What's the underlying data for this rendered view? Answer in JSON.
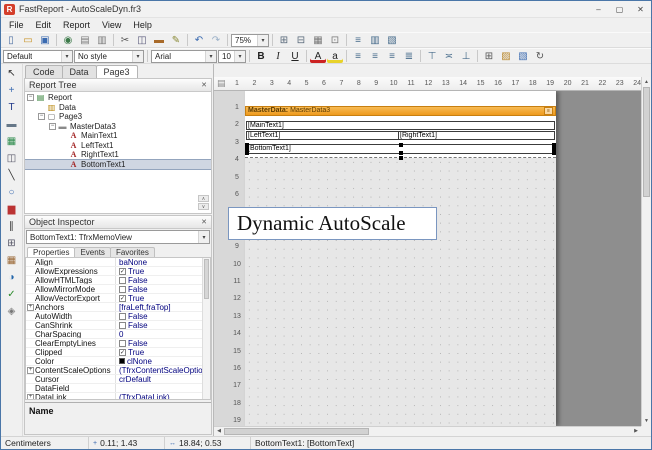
{
  "window": {
    "title": "FastReport - AutoScaleDyn.fr3",
    "icon": "R",
    "buttons": [
      {
        "name": "minimize-button",
        "glyph": "–"
      },
      {
        "name": "maximize-button",
        "glyph": "▢"
      },
      {
        "name": "close-button",
        "glyph": "✕"
      }
    ]
  },
  "menu": {
    "items": [
      "File",
      "Edit",
      "Report",
      "View",
      "Help"
    ]
  },
  "toolbar1": {
    "items": [
      {
        "type": "icon",
        "name": "new-report-button",
        "glyph": "▯",
        "color": "#4a6da0"
      },
      {
        "type": "icon",
        "name": "open-report-button",
        "glyph": "▭",
        "color": "#c89020"
      },
      {
        "type": "icon",
        "name": "save-report-button",
        "glyph": "▣",
        "color": "#3a6ab0"
      },
      {
        "type": "sep"
      },
      {
        "type": "icon",
        "name": "preview-button",
        "glyph": "◉",
        "color": "#3d7a4a"
      },
      {
        "type": "icon",
        "name": "new-page-button",
        "glyph": "▤",
        "color": "#7a7a7a"
      },
      {
        "type": "icon",
        "name": "page-settings-button",
        "glyph": "▥",
        "color": "#7a7a7a"
      },
      {
        "type": "sep"
      },
      {
        "type": "icon",
        "name": "cut-button",
        "glyph": "✂",
        "color": "#555555"
      },
      {
        "type": "icon",
        "name": "copy-button",
        "glyph": "◫",
        "color": "#555577"
      },
      {
        "type": "icon",
        "name": "paste-button",
        "glyph": "▬",
        "color": "#a86a2a"
      },
      {
        "type": "icon",
        "name": "format-painter-button",
        "glyph": "✎",
        "color": "#888833"
      },
      {
        "type": "sep"
      },
      {
        "type": "icon",
        "name": "undo-button",
        "glyph": "↶",
        "color": "#3a6ab0"
      },
      {
        "type": "icon",
        "name": "redo-button",
        "glyph": "↷",
        "color": "#9ab0c8"
      },
      {
        "type": "sep"
      },
      {
        "type": "combo",
        "name": "zoom-select",
        "value": "75%",
        "width": 38
      },
      {
        "type": "sep"
      },
      {
        "type": "icon",
        "name": "group-button",
        "glyph": "⊞",
        "color": "#556677"
      },
      {
        "type": "icon",
        "name": "ungroup-button",
        "glyph": "⊟",
        "color": "#556677"
      },
      {
        "type": "icon",
        "name": "show-grid-button",
        "glyph": "▦",
        "color": "#777777"
      },
      {
        "type": "icon",
        "name": "align-to-grid-button",
        "glyph": "⊡",
        "color": "#777777"
      },
      {
        "type": "sep"
      },
      {
        "type": "icon",
        "name": "report-tree-toggle",
        "glyph": "≡",
        "color": "#456a8a"
      },
      {
        "type": "icon",
        "name": "data-tree-toggle",
        "glyph": "▥",
        "color": "#456a8a"
      },
      {
        "type": "icon",
        "name": "inspector-toggle",
        "glyph": "▧",
        "color": "#456a8a"
      }
    ]
  },
  "toolbar2": {
    "items": [
      {
        "type": "combo",
        "name": "style-select",
        "value": "Default",
        "width": 70
      },
      {
        "type": "combo",
        "name": "style2-select",
        "value": "No style",
        "width": 70
      },
      {
        "type": "sep"
      },
      {
        "type": "combo",
        "name": "font-select",
        "value": "Arial",
        "width": 66
      },
      {
        "type": "combo",
        "name": "font-size-select",
        "value": "10",
        "width": 28
      },
      {
        "type": "sep"
      },
      {
        "type": "icon",
        "name": "bold-button",
        "glyph": "B",
        "b": true,
        "color": "#222222"
      },
      {
        "type": "icon",
        "name": "italic-button",
        "glyph": "I",
        "i": true,
        "color": "#222222"
      },
      {
        "type": "icon",
        "name": "underline-button",
        "glyph": "U",
        "u": true,
        "color": "#222222"
      },
      {
        "type": "sep"
      },
      {
        "type": "icon",
        "name": "font-color-button",
        "glyph": "A",
        "color": "#222222",
        "bar": "#cc2222"
      },
      {
        "type": "icon",
        "name": "highlight-color-button",
        "glyph": "a",
        "color": "#222222",
        "bar": "#e8d22a"
      },
      {
        "type": "sep"
      },
      {
        "type": "icon",
        "name": "align-left-button",
        "glyph": "≡",
        "color": "#456a8a"
      },
      {
        "type": "icon",
        "name": "align-center-button",
        "glyph": "≡",
        "color": "#456a8a"
      },
      {
        "type": "icon",
        "name": "align-right-button",
        "glyph": "≡",
        "color": "#456a8a"
      },
      {
        "type": "icon",
        "name": "align-justify-button",
        "glyph": "≣",
        "color": "#456a8a"
      },
      {
        "type": "sep"
      },
      {
        "type": "icon",
        "name": "valign-top-button",
        "glyph": "⊤",
        "color": "#456a8a"
      },
      {
        "type": "icon",
        "name": "valign-middle-button",
        "glyph": "≍",
        "color": "#456a8a"
      },
      {
        "type": "icon",
        "name": "valign-bottom-button",
        "glyph": "⊥",
        "color": "#456a8a"
      },
      {
        "type": "sep"
      },
      {
        "type": "icon",
        "name": "borders-button",
        "glyph": "⊞",
        "color": "#555555"
      },
      {
        "type": "icon",
        "name": "fill-color-button",
        "glyph": "▨",
        "color": "#b8862a"
      },
      {
        "type": "icon",
        "name": "line-color-button",
        "glyph": "▧",
        "color": "#3a6ab0"
      },
      {
        "type": "icon",
        "name": "rotate-button",
        "glyph": "↻",
        "color": "#555555"
      }
    ]
  },
  "page_tabs": {
    "tabs": [
      {
        "label": "Code"
      },
      {
        "label": "Data"
      },
      {
        "label": "Page3",
        "active": true
      }
    ]
  },
  "tool_dock": {
    "items": [
      {
        "name": "select-tool",
        "glyph": "↖",
        "color": "#333333"
      },
      {
        "name": "hand-tool",
        "glyph": "+",
        "color": "#3a6ab0"
      },
      {
        "name": "text-object-tool",
        "glyph": "T",
        "color": "#223a8a"
      },
      {
        "name": "band-object-tool",
        "glyph": "▬",
        "color": "#667788"
      },
      {
        "name": "picture-object-tool",
        "glyph": "▦",
        "color": "#2a8a4a"
      },
      {
        "name": "subreport-object-tool",
        "glyph": "◫",
        "color": "#555566"
      },
      {
        "name": "line-object-tool",
        "glyph": "╲",
        "color": "#333333"
      },
      {
        "name": "shape-object-tool",
        "glyph": "○",
        "color": "#3a6ab0"
      },
      {
        "name": "chart-object-tool",
        "glyph": "▆",
        "color": "#bb3333"
      },
      {
        "name": "barcode-object-tool",
        "glyph": "∥",
        "color": "#333333"
      },
      {
        "name": "crosstab-object-tool",
        "glyph": "⊞",
        "color": "#555566"
      },
      {
        "name": "table-object-tool",
        "glyph": "▦",
        "color": "#996633"
      },
      {
        "name": "gauge-object-tool",
        "glyph": "◑",
        "color": "#2266aa"
      },
      {
        "name": "checkbox-object-tool",
        "glyph": "✓",
        "color": "#2a8a2a"
      },
      {
        "name": "map-object-tool",
        "glyph": "◈",
        "color": "#777777"
      }
    ]
  },
  "report_tree": {
    "title": "Report Tree",
    "nodes": [
      {
        "label": "Report",
        "depth": 0,
        "icon": "report",
        "expander": "−"
      },
      {
        "label": "Data",
        "depth": 1,
        "icon": "data"
      },
      {
        "label": "Page3",
        "depth": 1,
        "icon": "page",
        "expander": "−"
      },
      {
        "label": "MasterData3",
        "depth": 2,
        "icon": "band",
        "expander": "−"
      },
      {
        "label": "MainText1",
        "depth": 3,
        "icon": "memo"
      },
      {
        "label": "LeftText1",
        "depth": 3,
        "icon": "memo"
      },
      {
        "label": "RightText1",
        "depth": 3,
        "icon": "memo"
      },
      {
        "label": "BottomText1",
        "depth": 3,
        "icon": "memo",
        "selected": true
      }
    ]
  },
  "object_inspector": {
    "title": "Object Inspector",
    "selected_object": "BottomText1: TfrxMemoView",
    "tabs": [
      {
        "label": "Properties",
        "active": true
      },
      {
        "label": "Events"
      },
      {
        "label": "Favorites"
      }
    ],
    "properties": [
      {
        "name": "Align",
        "value": "baNone"
      },
      {
        "name": "AllowExpressions",
        "value": "True",
        "bool": true,
        "checked": true
      },
      {
        "name": "AllowHTMLTags",
        "value": "False",
        "bool": true,
        "checked": false
      },
      {
        "name": "AllowMirrorMode",
        "value": "False",
        "bool": true,
        "checked": false
      },
      {
        "name": "AllowVectorExport",
        "value": "True",
        "bool": true,
        "checked": true
      },
      {
        "name": "Anchors",
        "value": "[fraLeft,fraTop]",
        "expandable": true
      },
      {
        "name": "AutoWidth",
        "value": "False",
        "bool": true,
        "checked": false
      },
      {
        "name": "CanShrink",
        "value": "False",
        "bool": true,
        "checked": false
      },
      {
        "name": "CharSpacing",
        "value": "0"
      },
      {
        "name": "ClearEmptyLines",
        "value": "False",
        "bool": true,
        "checked": false
      },
      {
        "name": "Clipped",
        "value": "True",
        "bool": true,
        "checked": true
      },
      {
        "name": "Color",
        "value": "clNone",
        "swatch": "#000000"
      },
      {
        "name": "ContentScaleOptions",
        "value": "(TfrxContentScaleOptions)",
        "expandable": true
      },
      {
        "name": "Cursor",
        "value": "crDefault"
      },
      {
        "name": "DataField",
        "value": ""
      },
      {
        "name": "DataLink",
        "value": "(TfrxDataLink)",
        "expandable": true
      }
    ],
    "footer_label": "Name"
  },
  "design": {
    "h_ruler_numbers": [
      1,
      2,
      3,
      4,
      5,
      6,
      7,
      8,
      9,
      10,
      11,
      12,
      13,
      14,
      15,
      16,
      17,
      18,
      19,
      20,
      21,
      22,
      23,
      24
    ],
    "v_ruler_numbers": [
      1,
      2,
      3,
      4,
      5,
      6,
      7,
      8,
      9,
      10,
      11,
      12,
      13,
      14,
      15,
      16,
      17,
      18,
      19
    ],
    "band": {
      "prefix": "MasterData:",
      "name": "MasterData3"
    },
    "fields": {
      "main": "[MainText1]",
      "left": "[LeftText1]",
      "right": "[RightText1]",
      "bottom": "[BottomText1]"
    },
    "overlay_text": "Dynamic AutoScale"
  },
  "statusbar": {
    "units": "Centimeters",
    "position": "0.11; 1.43",
    "size": "18.84; 0.53",
    "object_info": "BottomText1: [BottomText]"
  },
  "ui": {
    "close_glyph": "✕",
    "dropdown": "▾",
    "corner_icon": "▤",
    "band_icon": "≡",
    "position_icon": "+",
    "size_icon": "↔",
    "arrow_up": "▲",
    "arrow_down": "▼",
    "arrow_left": "◀",
    "arrow_right": "▶",
    "scroll_up": "∧",
    "scroll_down": "∨"
  }
}
